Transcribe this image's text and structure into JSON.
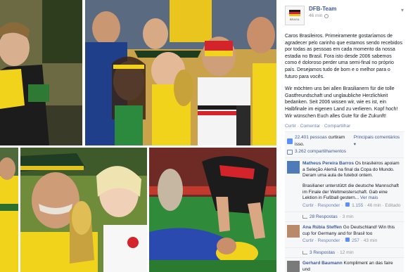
{
  "post": {
    "page_name": "DFB-Team",
    "time": "46 min",
    "logo_text": "BRASIL",
    "text_pt": "Caros Brasileiros. Primeiramente gostaríamos de agradecer pelo carinho que estamos sendo recebidos por todas as pessoas em cada momento da nossa estadia no Brasil. Fora isto desde 2006 sabemos como é doloroso perder uma semi-final no próprio país. Desejamos tudo de bom e o melhor para o futuro para vocês.",
    "text_de": "Wir möchten uns bei allen Brasilianern für die tolle Gastfreundschaft und unglaubliche Herzlichkeit bedanken. Seit 2006 wissen wir, wie es ist, ein Halbfinale im eigenen Land zu verlieren. Kopf hoch! Wir wünschen Euch alles Gute für die Zukunft!",
    "actions": {
      "like": "Curtir",
      "comment": "Comentar",
      "share": "Compartilhar",
      "separator": "·"
    }
  },
  "stats": {
    "likes_count": "22.401 pessoas",
    "likes_suffix": "curtiram isso.",
    "sort_label": "Principais comentários ▾",
    "shares": "3.262 compartilhamentos"
  },
  "comments": [
    {
      "name": "Matheus Pereira Barros",
      "text": "Os brasileiros apoiam a Seleção Alemã na final da Copa do Mundo. Deram uma aula de futebol ontem.",
      "text2": "Brasilianer unterstützt die deutsche Mannschaft im Finale der Weltmeisterschaft. Gab eine Lektion in Fußball gestern...",
      "see_more": "Ver mais",
      "meta_actions": "Curtir · Responder ·",
      "likes": "1.155",
      "time": "· 46 min · Editado",
      "replies": "28 Respostas",
      "replies_time": "· 3 min"
    },
    {
      "name": "Ana Rúbia Steffen",
      "text": "Go Deutschland! Win this cup for Germany and for Brasil too",
      "meta_actions": "Curtir · Responder ·",
      "likes": "257",
      "time": "· 43 min",
      "replies": "3 Respostas",
      "replies_time": "· 12 min"
    },
    {
      "name": "Gerhard Baumann",
      "text": "Kompliment an das faire und"
    }
  ],
  "colors": {
    "link": "#3b5998",
    "muted": "#90949c",
    "like_blue": "#5890ff"
  },
  "icons": [
    "globe-icon",
    "chevron-down-icon",
    "thumb-up-icon",
    "share-icon",
    "reply-icon"
  ]
}
